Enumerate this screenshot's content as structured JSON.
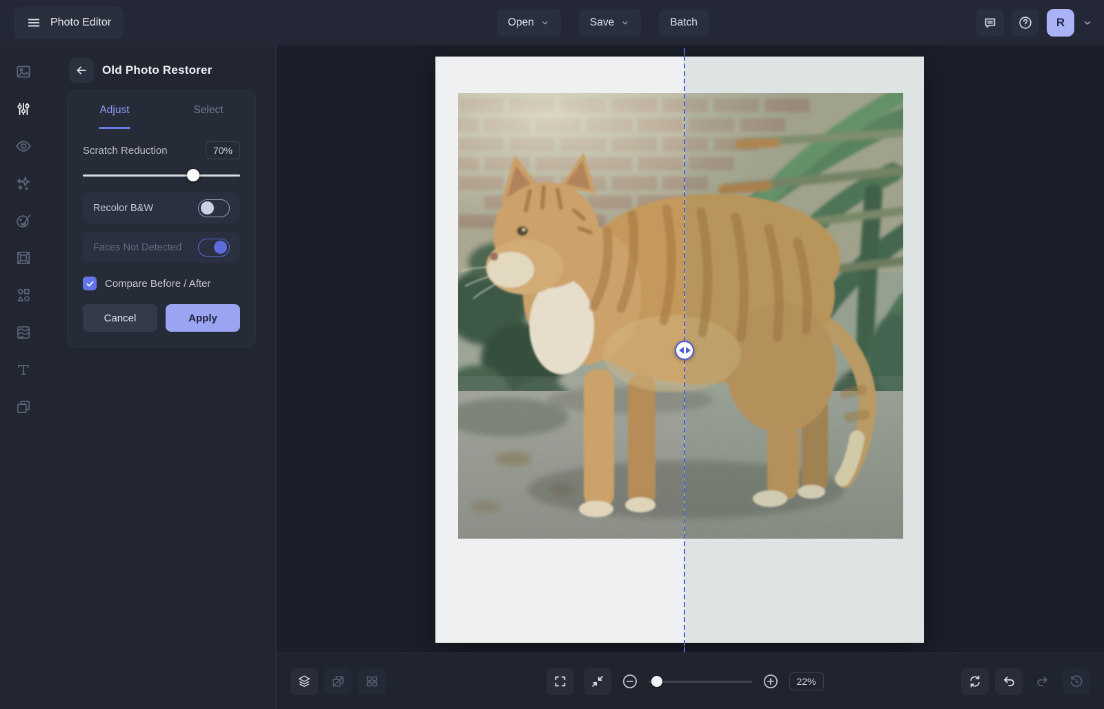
{
  "topbar": {
    "menu_label": "Photo Editor",
    "open_label": "Open",
    "save_label": "Save",
    "batch_label": "Batch",
    "avatar_initial": "R",
    "icons": {
      "menu": "hamburger-icon",
      "feedback": "speech-bubble-icon",
      "help": "question-circle-icon",
      "account": "chevron-down-icon"
    }
  },
  "sidebar": {
    "items": [
      {
        "icon": "image-icon",
        "active": false
      },
      {
        "icon": "adjust-sliders-icon",
        "active": true
      },
      {
        "icon": "eye-icon",
        "active": false
      },
      {
        "icon": "sparkles-icon",
        "active": false
      },
      {
        "icon": "palette-icon",
        "active": false
      },
      {
        "icon": "frame-icon",
        "active": false
      },
      {
        "icon": "shapes-icon",
        "active": false
      },
      {
        "icon": "texture-icon",
        "active": false
      },
      {
        "icon": "text-icon",
        "active": false
      },
      {
        "icon": "overlap-squares-icon",
        "active": false
      }
    ]
  },
  "panel": {
    "title": "Old Photo Restorer",
    "tabs": [
      {
        "label": "Adjust",
        "active": true
      },
      {
        "label": "Select",
        "active": false
      }
    ],
    "scratch": {
      "label": "Scratch Reduction",
      "value": "70%",
      "value_percent": 70
    },
    "toggles": [
      {
        "label": "Recolor B&W",
        "state": "off"
      },
      {
        "label": "Faces Not Detected",
        "state": "on",
        "disabled": true
      }
    ],
    "compare_checkbox": {
      "label": "Compare Before / After",
      "checked": true
    },
    "cancel_label": "Cancel",
    "apply_label": "Apply"
  },
  "canvas": {
    "content": "polaroid photo of a ginger tabby cat standing on gravel by a brick wall and green plants",
    "divider": "before-after compare divider"
  },
  "bottombar": {
    "left_icons": [
      "layers-icon",
      "compare-view-icon",
      "grid-view-icon"
    ],
    "center_icons": [
      "fullscreen-icon",
      "fit-screen-icon",
      "zoom-out-icon",
      "zoom-in-icon"
    ],
    "zoom": {
      "level": "22%",
      "slider_percent": 8
    },
    "right_icons": [
      "reset-icon",
      "undo-icon",
      "redo-icon",
      "history-icon"
    ]
  },
  "colors": {
    "accent": "#6374e8",
    "accent_light": "#9aa4f3",
    "topbar_bg": "#242836",
    "panel_bg": "#212631",
    "canvas_bg": "#1b1f29",
    "card_bg": "#262b38",
    "chip_bg": "#2a2f3d"
  }
}
